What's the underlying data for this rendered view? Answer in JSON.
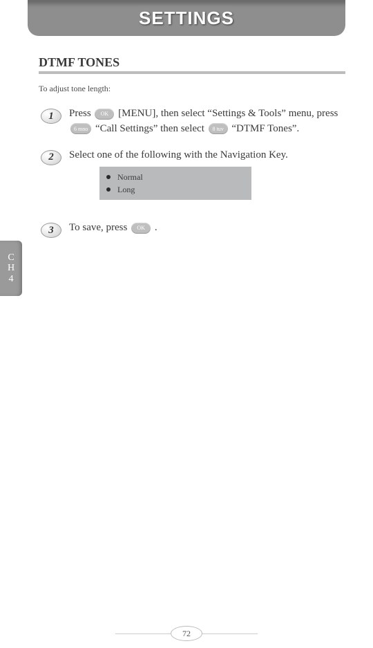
{
  "header": {
    "title": "SETTINGS"
  },
  "section": {
    "title": "DTMF TONES",
    "intro": "To adjust tone length:"
  },
  "chapter_tab": {
    "line1": "C",
    "line2": "H",
    "line3": "4"
  },
  "steps": {
    "s1": {
      "num": "1",
      "pre": "Press ",
      "key1": "OK",
      "mid1": " [MENU], then select “Settings & Tools” menu, press ",
      "key2": "6 mno",
      "mid2": " “Call Settings” then select ",
      "key3": "8 tuv",
      "post": " “DTMF Tones”."
    },
    "s2": {
      "num": "2",
      "text": "Select one of the following with the Navigation Key."
    },
    "s3": {
      "num": "3",
      "pre": "To save, press ",
      "key1": "OK",
      "post": " ."
    }
  },
  "options": {
    "opt1": "Normal",
    "opt2": "Long"
  },
  "page_number": "72"
}
